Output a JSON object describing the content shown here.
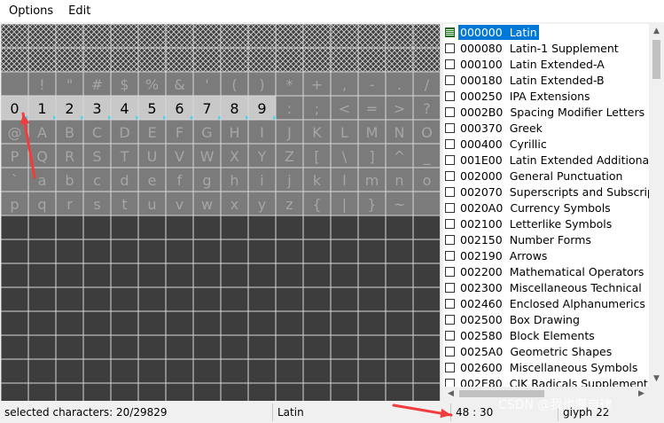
{
  "menu": {
    "items": [
      "Options",
      "Edit"
    ]
  },
  "grid": {
    "columns": 16,
    "hatched_rows": 2,
    "char_rows": [
      [
        "",
        "!",
        "\"",
        "#",
        "$",
        "%",
        "&",
        "'",
        "(",
        ")",
        "*",
        "+",
        ",",
        "-",
        ".",
        "/"
      ],
      [
        "0",
        "1",
        "2",
        "3",
        "4",
        "5",
        "6",
        "7",
        "8",
        "9",
        ":",
        ";",
        "<",
        "=",
        ">",
        "?"
      ],
      [
        "@",
        "A",
        "B",
        "C",
        "D",
        "E",
        "F",
        "G",
        "H",
        "I",
        "J",
        "K",
        "L",
        "M",
        "N",
        "O"
      ],
      [
        "P",
        "Q",
        "R",
        "S",
        "T",
        "U",
        "V",
        "W",
        "X",
        "Y",
        "Z",
        "[",
        "\\",
        "]",
        "^",
        "_"
      ],
      [
        "`",
        "a",
        "b",
        "c",
        "d",
        "e",
        "f",
        "g",
        "h",
        "i",
        "j",
        "k",
        "l",
        "m",
        "n",
        "o"
      ],
      [
        "p",
        "q",
        "r",
        "s",
        "t",
        "u",
        "v",
        "w",
        "x",
        "y",
        "z",
        "{",
        "|",
        "}",
        "~",
        ""
      ]
    ],
    "selected_row": 1,
    "selected_count": 10,
    "colors": {
      "empty": "#3d3d3d",
      "chars_bg": "#7b7b7b",
      "chars_text": "#a6a6a6",
      "selected_bg": "#c8c8c8",
      "selected_text": "#000000",
      "grid_line": "#d8d8d8",
      "marker": "#4fd2ee"
    }
  },
  "unicode_blocks": {
    "selected_index": 0,
    "items": [
      {
        "code": "000000",
        "name": "Latin",
        "checked": true
      },
      {
        "code": "000080",
        "name": "Latin-1 Supplement",
        "checked": false
      },
      {
        "code": "000100",
        "name": "Latin Extended-A",
        "checked": false
      },
      {
        "code": "000180",
        "name": "Latin Extended-B",
        "checked": false
      },
      {
        "code": "000250",
        "name": "IPA Extensions",
        "checked": false
      },
      {
        "code": "0002B0",
        "name": "Spacing Modifier Letters",
        "checked": false
      },
      {
        "code": "000370",
        "name": "Greek",
        "checked": false
      },
      {
        "code": "000400",
        "name": "Cyrillic",
        "checked": false
      },
      {
        "code": "001E00",
        "name": "Latin Extended Additional",
        "checked": false
      },
      {
        "code": "002000",
        "name": "General Punctuation",
        "checked": false
      },
      {
        "code": "002070",
        "name": "Superscripts and Subscripts",
        "checked": false
      },
      {
        "code": "0020A0",
        "name": "Currency Symbols",
        "checked": false
      },
      {
        "code": "002100",
        "name": "Letterlike Symbols",
        "checked": false
      },
      {
        "code": "002150",
        "name": "Number Forms",
        "checked": false
      },
      {
        "code": "002190",
        "name": "Arrows",
        "checked": false
      },
      {
        "code": "002200",
        "name": "Mathematical Operators",
        "checked": false
      },
      {
        "code": "002300",
        "name": "Miscellaneous Technical",
        "checked": false
      },
      {
        "code": "002460",
        "name": "Enclosed Alphanumerics",
        "checked": false
      },
      {
        "code": "002500",
        "name": "Box Drawing",
        "checked": false
      },
      {
        "code": "002580",
        "name": "Block Elements",
        "checked": false
      },
      {
        "code": "0025A0",
        "name": "Geometric Shapes",
        "checked": false
      },
      {
        "code": "002600",
        "name": "Miscellaneous Symbols",
        "checked": false
      },
      {
        "code": "002E80",
        "name": "CJK Radicals Supplement",
        "checked": false
      }
    ]
  },
  "status": {
    "selected": "selected characters: 20/29829",
    "block": "Latin",
    "coords": "48 : 30",
    "glyph": "glyph 22"
  },
  "watermark": "CSDN @我也要自律",
  "annotation_color": "#f03c3c"
}
